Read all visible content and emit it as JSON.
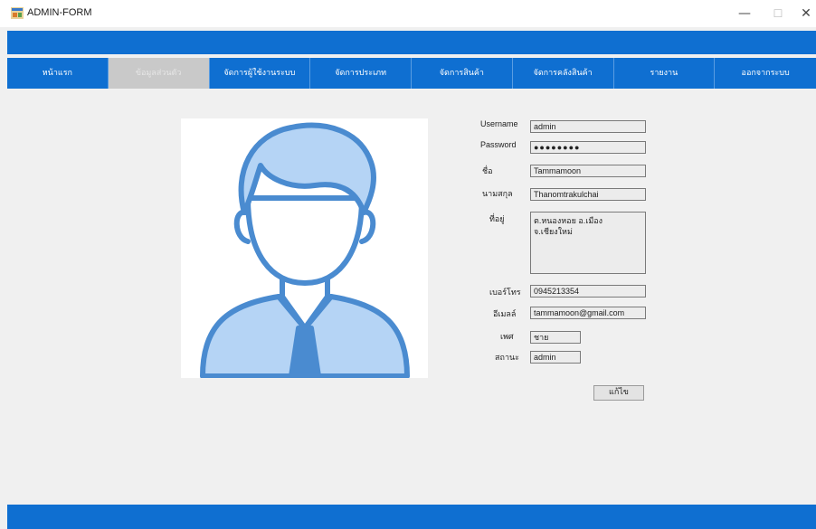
{
  "window": {
    "title": "ADMIN-FORM",
    "min": "—",
    "max": "☐",
    "close": "✕"
  },
  "menu": [
    {
      "label": "หน้าแรก"
    },
    {
      "label": "ข้อมูลส่วนตัว"
    },
    {
      "label": "จัดการผู้ใช้งานระบบ"
    },
    {
      "label": "จัดการประเภท"
    },
    {
      "label": "จัดการสินค้า"
    },
    {
      "label": "จัดการคลังสินค้า"
    },
    {
      "label": "รายงาน"
    },
    {
      "label": "ออกจากระบบ"
    }
  ],
  "active_menu": "ข้อมูลส่วนตัว",
  "form": {
    "username_label": "Username",
    "username": "admin",
    "password_label": "Password",
    "password": "●●●●●●●●",
    "firstname_label": "ชื่อ",
    "firstname": "Tammamoon",
    "lastname_label": "นามสกุล",
    "lastname": "Thanomtrakulchai",
    "address_label": "ที่อยู่",
    "address": "ต.หนองหอย อ.เมือง จ.เชียงใหม่",
    "phone_label": "เบอร์โทร",
    "phone": "0945213354",
    "email_label": "อีเมลล์",
    "email": "tammamoon@gmail.com",
    "gender_label": "เพศ",
    "gender": "ชาย",
    "status_label": "สถานะ",
    "status": "admin",
    "edit_button": "แก้ไข"
  },
  "colors": {
    "accent": "#0f6fd1",
    "active_menu": "#c9c9c9",
    "avatar_stroke": "#4a8bd0",
    "avatar_fill": "#b5d4f5"
  },
  "icons": {
    "app": "form-app-icon",
    "avatar": "user-avatar-icon"
  }
}
